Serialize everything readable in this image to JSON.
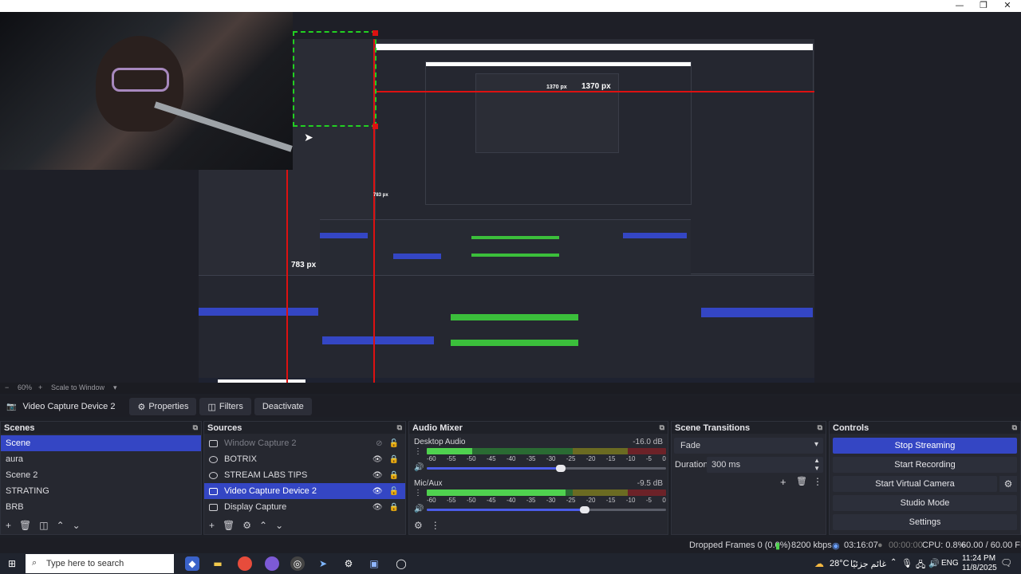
{
  "window": {
    "minimize": "—",
    "maximize": "❐",
    "close": "✕"
  },
  "preview": {
    "measure_h": "1370 px",
    "measure_v": "783 px",
    "nested_measure_h": "1370 px",
    "nested_measure_v": "783 px"
  },
  "zoom": {
    "level": "60%",
    "mode": "Scale to Window",
    "minus": "−",
    "plus": "+"
  },
  "context": {
    "source_name": "Video Capture Device 2",
    "properties": "Properties",
    "filters": "Filters",
    "deactivate": "Deactivate"
  },
  "scenes": {
    "title": "Scenes",
    "items": [
      "Scene",
      "aura",
      "Scene 2",
      "STRATING",
      "BRB"
    ]
  },
  "sources": {
    "title": "Sources",
    "items": [
      {
        "name": "Window Capture 2",
        "icon": "window-icon"
      },
      {
        "name": "BOTRIX",
        "icon": "globe-icon"
      },
      {
        "name": "STREAM LABS TIPS",
        "icon": "globe-icon"
      },
      {
        "name": "Video Capture Device 2",
        "icon": "camera-icon"
      },
      {
        "name": "Display Capture",
        "icon": "monitor-icon"
      }
    ]
  },
  "mixer": {
    "title": "Audio Mixer",
    "channels": [
      {
        "name": "Desktop Audio",
        "db": "-16.0 dB",
        "level": 0.19,
        "volume": 0.56
      },
      {
        "name": "Mic/Aux",
        "db": "-9.5 dB",
        "level": 0.58,
        "volume": 0.66
      }
    ],
    "ticks": [
      "-60",
      "-55",
      "-50",
      "-45",
      "-40",
      "-35",
      "-30",
      "-25",
      "-20",
      "-15",
      "-10",
      "-5",
      "0"
    ]
  },
  "transitions": {
    "title": "Scene Transitions",
    "selected": "Fade",
    "duration_label": "Duration",
    "duration_value": "300 ms"
  },
  "controls": {
    "title": "Controls",
    "stop_streaming": "Stop Streaming",
    "start_recording": "Start Recording",
    "start_virtual_camera": "Start Virtual Camera",
    "studio_mode": "Studio Mode",
    "settings": "Settings"
  },
  "status": {
    "dropped": "Dropped Frames 0 (0.0%)",
    "bitrate": "8200 kbps",
    "stream_time": "03:16:07",
    "rec_time": "00:00:00",
    "cpu": "CPU: 0.8%",
    "fps": "60.00 / 60.00 FPS"
  },
  "taskbar": {
    "search_placeholder": "Type here to search",
    "weather": "28°C",
    "weather_text": "غائم جزئيًا",
    "lang": "ENG",
    "time": "11:24 PM",
    "date": "11/8/2025"
  },
  "colors": {
    "accent": "#3446c4",
    "guide_red": "#d11111",
    "green_meter": "#4fd14f"
  }
}
